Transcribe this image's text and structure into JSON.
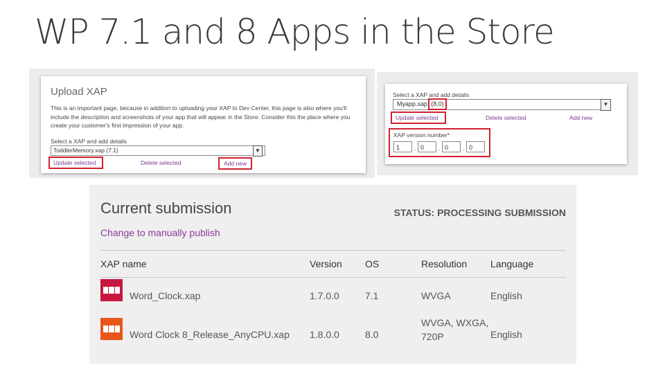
{
  "slide": {
    "title": "WP 7.1 and 8 Apps in the Store"
  },
  "upload_panel": {
    "title": "Upload XAP",
    "description": "This is an important page, because in addition to uploading your XAP to Dev Center, this page is also where you'll include the description and screenshots of your app that will appear in the Store. Consider this the place where you create your customer's first impression of your app.",
    "select_label": "Select a XAP and add details",
    "selected_value": "ToddlerMemory.xap (7.1)",
    "update_label": "Update selected",
    "delete_label": "Delete selected",
    "add_label": "Add new"
  },
  "version_panel": {
    "select_label": "Select a XAP and add details",
    "selected_file": "Myapp.xap",
    "selected_version": "(8.0)",
    "update_label": "Update selected",
    "delete_label": "Delete selected",
    "add_label": "Add new",
    "version_label": "XAP version number*",
    "version_fields": [
      "1",
      "0",
      "0",
      "0"
    ]
  },
  "submission": {
    "title": "Current submission",
    "status": "STATUS: PROCESSING SUBMISSION",
    "change_link": "Change to manually publish",
    "columns": [
      "XAP name",
      "Version",
      "OS",
      "Resolution",
      "Language"
    ],
    "rows": [
      {
        "name": "Word_Clock.xap",
        "version": "1.7.0.0",
        "os": "7.1",
        "resolution": "WVGA",
        "language": "English",
        "icon": "app-tile-icon",
        "icon_color": "#c8173f"
      },
      {
        "name": "Word Clock 8_Release_AnyCPU.xap",
        "version": "1.8.0.0",
        "os": "8.0",
        "resolution": "WVGA, WXGA, 720P",
        "language": "English",
        "icon": "app-tile-icon",
        "icon_color": "#e8561a"
      }
    ]
  }
}
